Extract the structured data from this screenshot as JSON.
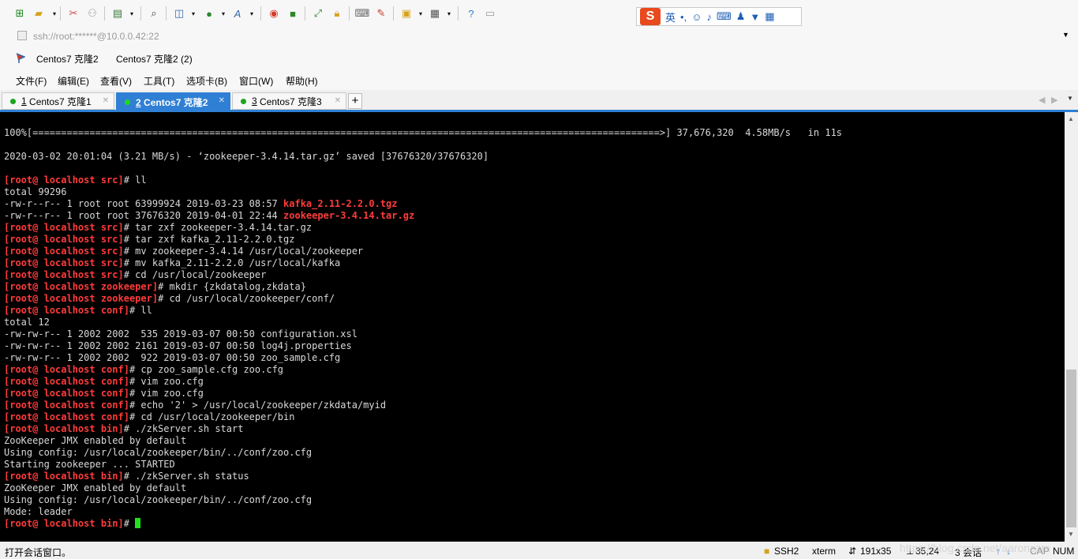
{
  "address": {
    "text": "ssh://root:******@10.0.0.42:22"
  },
  "bookmarks": [
    "Centos7 克隆2",
    "Centos7 克隆2 (2)"
  ],
  "menu": [
    "文件(F)",
    "编辑(E)",
    "查看(V)",
    "工具(T)",
    "选项卡(B)",
    "窗口(W)",
    "帮助(H)"
  ],
  "ime": {
    "logo": "S",
    "lang": "英"
  },
  "tabs": [
    {
      "num": "1",
      "label": "Centos7 克隆1",
      "active": false
    },
    {
      "num": "2",
      "label": "Centos7 克隆2",
      "active": true
    },
    {
      "num": "3",
      "label": "Centos7 克隆3",
      "active": false
    }
  ],
  "tab_add": "+",
  "terminal": {
    "lines": [
      {
        "t": "plain",
        "text": "100%[==============================================================================================================>] 37,676,320  4.58MB/s   in 11s"
      },
      {
        "t": "plain",
        "text": ""
      },
      {
        "t": "plain",
        "text": "2020-03-02 20:01:04 (3.21 MB/s) - ‘zookeeper-3.4.14.tar.gz’ saved [37676320/37676320]"
      },
      {
        "t": "plain",
        "text": ""
      },
      {
        "t": "cmd",
        "dir": "src",
        "cmd": "ll"
      },
      {
        "t": "plain",
        "text": "total 99296"
      },
      {
        "t": "file",
        "text": "-rw-r--r-- 1 root root 63999924 2019-03-23 08:57 ",
        "hl": "kafka_2.11-2.2.0.tgz"
      },
      {
        "t": "file",
        "text": "-rw-r--r-- 1 root root 37676320 2019-04-01 22:44 ",
        "hl": "zookeeper-3.4.14.tar.gz"
      },
      {
        "t": "cmd",
        "dir": "src",
        "cmd": "tar zxf zookeeper-3.4.14.tar.gz"
      },
      {
        "t": "cmd",
        "dir": "src",
        "cmd": "tar zxf kafka_2.11-2.2.0.tgz"
      },
      {
        "t": "cmd",
        "dir": "src",
        "cmd": "mv zookeeper-3.4.14 /usr/local/zookeeper"
      },
      {
        "t": "cmd",
        "dir": "src",
        "cmd": "mv kafka_2.11-2.2.0 /usr/local/kafka"
      },
      {
        "t": "cmd",
        "dir": "src",
        "cmd": "cd /usr/local/zookeeper"
      },
      {
        "t": "cmd",
        "dir": "zookeeper",
        "cmd": "mkdir {zkdatalog,zkdata}"
      },
      {
        "t": "cmd",
        "dir": "zookeeper",
        "cmd": "cd /usr/local/zookeeper/conf/"
      },
      {
        "t": "cmd",
        "dir": "conf",
        "cmd": "ll"
      },
      {
        "t": "plain",
        "text": "total 12"
      },
      {
        "t": "plain",
        "text": "-rw-rw-r-- 1 2002 2002  535 2019-03-07 00:50 configuration.xsl"
      },
      {
        "t": "plain",
        "text": "-rw-rw-r-- 1 2002 2002 2161 2019-03-07 00:50 log4j.properties"
      },
      {
        "t": "plain",
        "text": "-rw-rw-r-- 1 2002 2002  922 2019-03-07 00:50 zoo_sample.cfg"
      },
      {
        "t": "cmd",
        "dir": "conf",
        "cmd": "cp zoo_sample.cfg zoo.cfg"
      },
      {
        "t": "cmd",
        "dir": "conf",
        "cmd": "vim zoo.cfg"
      },
      {
        "t": "cmd",
        "dir": "conf",
        "cmd": "vim zoo.cfg"
      },
      {
        "t": "cmd",
        "dir": "conf",
        "cmd": "echo '2' > /usr/local/zookeeper/zkdata/myid"
      },
      {
        "t": "cmd",
        "dir": "conf",
        "cmd": "cd /usr/local/zookeeper/bin"
      },
      {
        "t": "cmd",
        "dir": "bin",
        "cmd": "./zkServer.sh start"
      },
      {
        "t": "plain",
        "text": "ZooKeeper JMX enabled by default"
      },
      {
        "t": "plain",
        "text": "Using config: /usr/local/zookeeper/bin/../conf/zoo.cfg"
      },
      {
        "t": "plain",
        "text": "Starting zookeeper ... STARTED"
      },
      {
        "t": "cmd",
        "dir": "bin",
        "cmd": "./zkServer.sh status"
      },
      {
        "t": "plain",
        "text": "ZooKeeper JMX enabled by default"
      },
      {
        "t": "plain",
        "text": "Using config: /usr/local/zookeeper/bin/../conf/zoo.cfg"
      },
      {
        "t": "plain",
        "text": "Mode: leader"
      },
      {
        "t": "prompt",
        "dir": "bin"
      }
    ],
    "prompt_user": "root@ localhost"
  },
  "status": {
    "left": "打开会话窗口。",
    "protocol": "SSH2",
    "term": "xterm",
    "size": "191x35",
    "cursor_pos": "35,24",
    "sessions": "3 会话",
    "caps": "CAP",
    "num": "NUM"
  },
  "watermark": "https://blog.csdn.net/aaronszm"
}
